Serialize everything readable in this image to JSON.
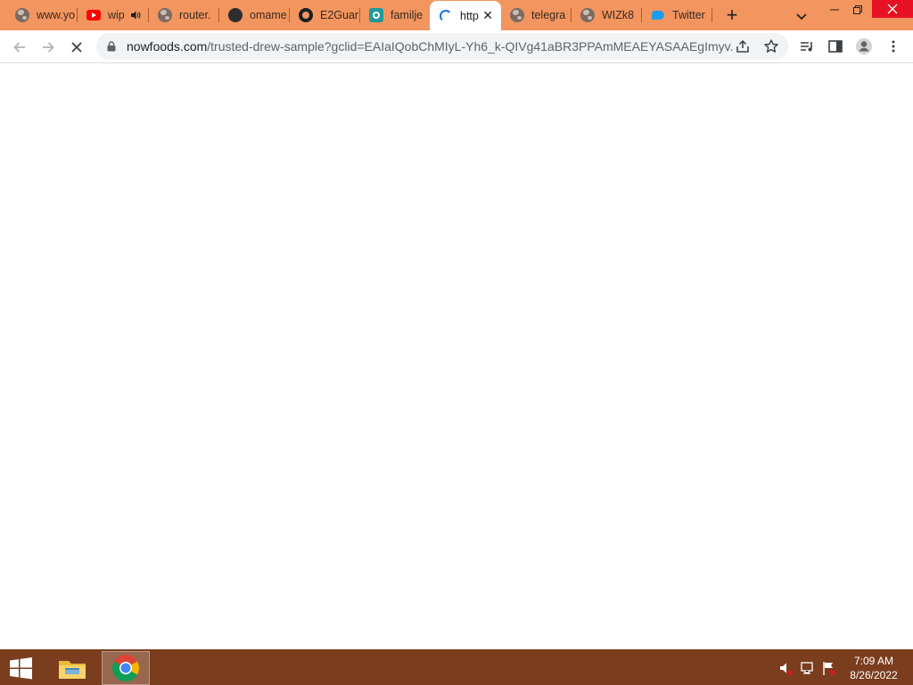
{
  "browser": {
    "tabs": [
      {
        "title": "www.yo",
        "icon": "globe-icon",
        "state": "normal"
      },
      {
        "title": "wip",
        "icon": "youtube-icon",
        "state": "audio"
      },
      {
        "title": "router.",
        "icon": "globe-icon",
        "state": "normal"
      },
      {
        "title": "omame",
        "icon": "owl-icon",
        "state": "normal"
      },
      {
        "title": "E2Guar",
        "icon": "github-icon",
        "state": "normal"
      },
      {
        "title": "familje",
        "icon": "familje-icon",
        "state": "normal"
      },
      {
        "title": "http",
        "icon": "loading-spinner-icon",
        "state": "active"
      },
      {
        "title": "telegra",
        "icon": "globe-icon",
        "state": "normal"
      },
      {
        "title": "WIZk8",
        "icon": "globe-icon",
        "state": "normal"
      },
      {
        "title": "Twitter",
        "icon": "twitter-icon",
        "state": "normal"
      }
    ],
    "address": {
      "host": "nowfoods.com",
      "path": "/trusted-drew-sample?gclid=EAIaIQobChMIyL-Yh6_k-QIVg41aBR3PPAmMEAEYASAAEgImyv..."
    },
    "colors": {
      "tabstrip": "#f2955e",
      "accent": "#1a73e8",
      "close_button": "#e81123"
    }
  },
  "taskbar": {
    "apps": [
      {
        "name": "File Explorer",
        "icon": "file-explorer-icon"
      },
      {
        "name": "Google Chrome",
        "icon": "chrome-icon",
        "active": true
      }
    ],
    "tray_icons": [
      "speaker-muted-icon",
      "network-icon",
      "action-center-flag-icon"
    ],
    "clock": {
      "time": "7:09 AM",
      "date": "8/26/2022"
    },
    "color": "#7a3d1e"
  }
}
